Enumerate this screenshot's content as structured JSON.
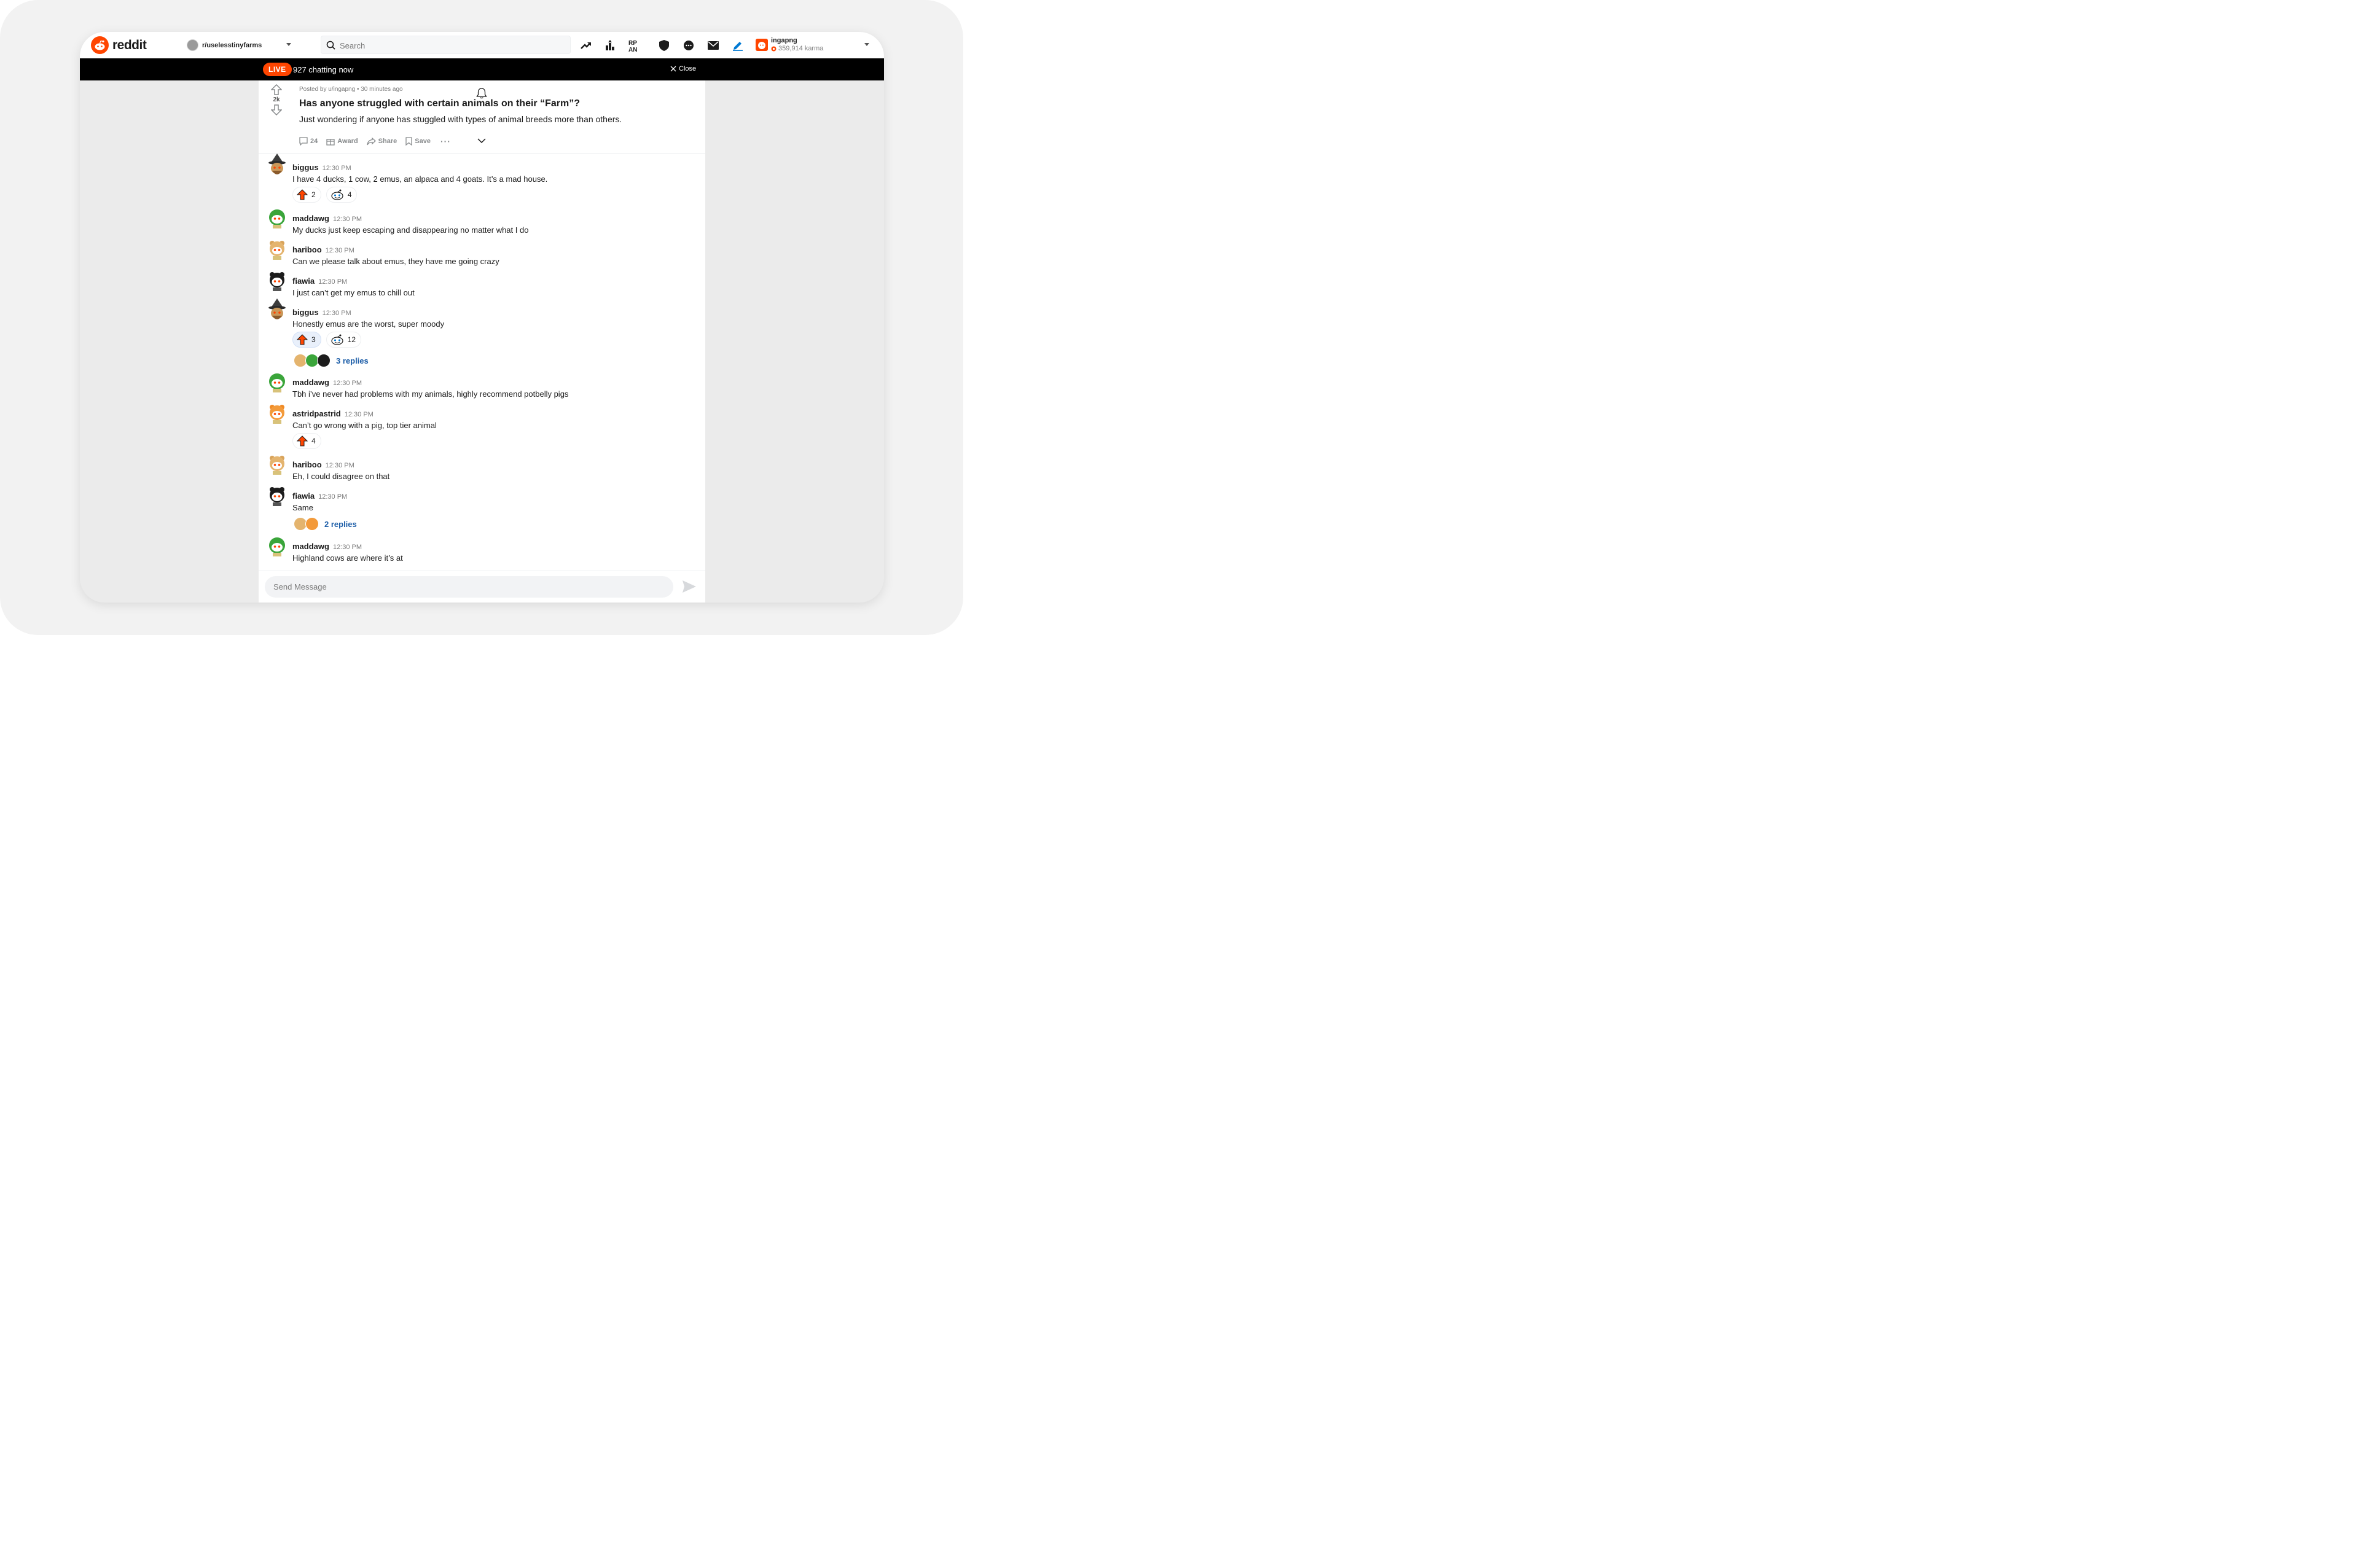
{
  "app": {
    "name": "reddit"
  },
  "header": {
    "community": "r/uselesstinyfarms",
    "search_placeholder": "Search",
    "user": {
      "name": "ingapng",
      "karma": "359,914 karma"
    }
  },
  "live": {
    "badge": "LIVE",
    "text": "927 chatting now",
    "close": "Close"
  },
  "post": {
    "votes": "2k",
    "meta": "Posted by u/ingapng • 30 minutes ago",
    "title": "Has anyone struggled with certain animals on their “Farm”?",
    "body": "Just wondering if anyone has stuggled with types of animal breeds more than others.",
    "actions": {
      "comments": "24",
      "award": "Award",
      "share": "Share",
      "save": "Save"
    }
  },
  "comments": [
    {
      "user": "biggus",
      "time": "12:30 PM",
      "text": "I have 4 ducks, 1 cow, 2 emus, an alpaca and 4 goats. It’s a mad house.",
      "reactions": [
        {
          "icon": "upvote-arrow",
          "count": "2"
        },
        {
          "icon": "snoo-face",
          "count": "4"
        }
      ]
    },
    {
      "user": "maddawg",
      "time": "12:30 PM",
      "text": "My ducks just keep escaping and disappearing no matter what I do"
    },
    {
      "user": "hariboo",
      "time": "12:30 PM",
      "text": "Can we please talk about emus, they have me going crazy"
    },
    {
      "user": "fiawia",
      "time": "12:30 PM",
      "text": "I just can’t get my emus to chill out"
    },
    {
      "user": "biggus",
      "time": "12:30 PM",
      "text": "Honestly emus are the worst, super moody",
      "reactions": [
        {
          "icon": "upvote-arrow",
          "count": "3"
        },
        {
          "icon": "snoo-face",
          "count": "12"
        }
      ],
      "replies": "3 replies"
    },
    {
      "user": "maddawg",
      "time": "12:30 PM",
      "text": "Tbh i’ve never had problems with my animals, highly recommend potbelly pigs"
    },
    {
      "user": "astridpastrid",
      "time": "12:30 PM",
      "text": "Can’t go wrong with a pig, top tier animal",
      "reactions": [
        {
          "icon": "upvote-arrow",
          "count": "4"
        }
      ]
    },
    {
      "user": "hariboo",
      "time": "12:30 PM",
      "text": "Eh, I could disagree on that"
    },
    {
      "user": "fiawia",
      "time": "12:30 PM",
      "text": "Same",
      "replies": "2 replies"
    },
    {
      "user": "maddawg",
      "time": "12:30 PM",
      "text": "Highland cows are where it’s at"
    }
  ],
  "composer": {
    "placeholder": "Send Message"
  },
  "colors": {
    "brand": "#ff4500",
    "link": "#1d5ea8",
    "live_bar": "#000000"
  }
}
